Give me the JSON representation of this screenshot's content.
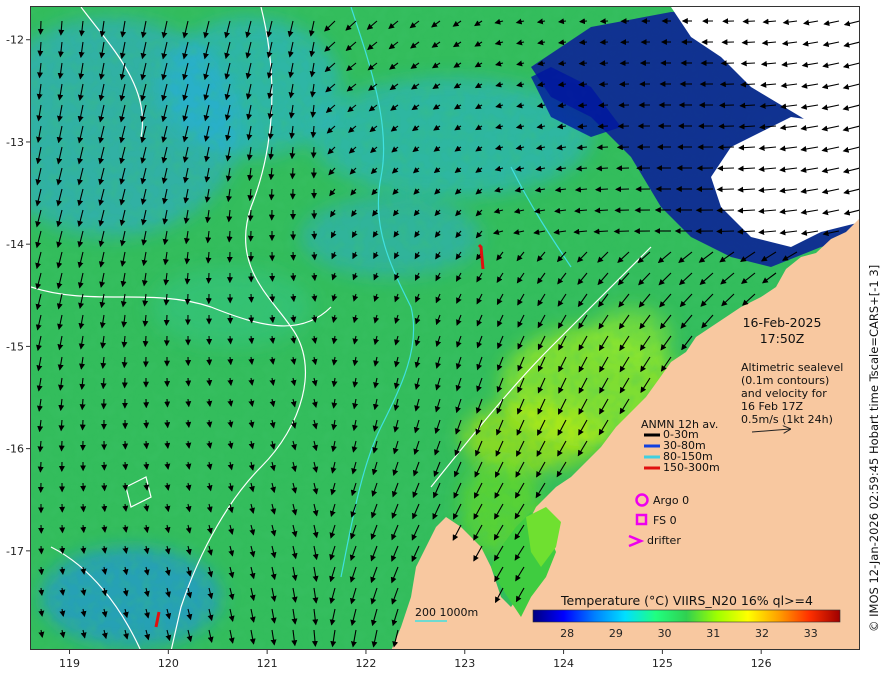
{
  "map": {
    "lon_range": [
      118.6,
      127.0
    ],
    "lat_range": [
      -17.97,
      -11.67
    ],
    "lon_ticks": [
      "119",
      "120",
      "121",
      "122",
      "123",
      "124",
      "125",
      "126"
    ],
    "lat_ticks": [
      "-12",
      "-13",
      "-14",
      "-15",
      "-16",
      "-17"
    ],
    "lon_tick_values": [
      119,
      120,
      121,
      122,
      123,
      124,
      125,
      126
    ],
    "lat_tick_values": [
      -12,
      -13,
      -14,
      -15,
      -16,
      -17
    ],
    "colors": {
      "land": "#f8c8a0",
      "cloud": "#ffffff",
      "ocean_base": "#35c060",
      "contour_200": "#40e0e0",
      "contour_1000": "#ffffff",
      "arrows": "#000000",
      "mooring": "#e01010",
      "magenta": "#ee00ee"
    }
  },
  "datetime": {
    "date": "16-Feb-2025",
    "time": "17:50Z"
  },
  "altimetry": {
    "line1": "Altimetric sealevel",
    "line2": "(0.1m contours)",
    "line3": "and velocity for",
    "line4": "16 Feb 17Z",
    "line5": "0.5m/s (1kt 24h)"
  },
  "anmn": {
    "title": "ANMN 12h av.",
    "items": [
      {
        "label": "0-30m",
        "color": "#000000"
      },
      {
        "label": "30-80m",
        "color": "#1040e0"
      },
      {
        "label": "80-150m",
        "color": "#40d0e0"
      },
      {
        "label": "150-300m",
        "color": "#e01010"
      }
    ]
  },
  "platforms": {
    "argo": "Argo 0",
    "fs": "FS 0",
    "drifter": "drifter"
  },
  "depth_legend": {
    "label": "200  1000m"
  },
  "colorbar": {
    "title": "Temperature (°C) VIIRS_N20 16% ql>=4",
    "ticks": [
      "28",
      "29",
      "30",
      "31",
      "32",
      "33"
    ],
    "tick_values": [
      28,
      29,
      30,
      31,
      32,
      33
    ],
    "range": [
      27.3,
      33.6
    ],
    "stops": [
      "#00007f",
      "#0000ff",
      "#007fff",
      "#00dfff",
      "#20ff80",
      "#30d050",
      "#9fff00",
      "#ffff00",
      "#ffa000",
      "#ff3000",
      "#9f0000"
    ]
  },
  "copyright": "© IMOS 12-Jan-2026 02:59:45 Hobart time Tscale=CARS+[-1 3]"
}
